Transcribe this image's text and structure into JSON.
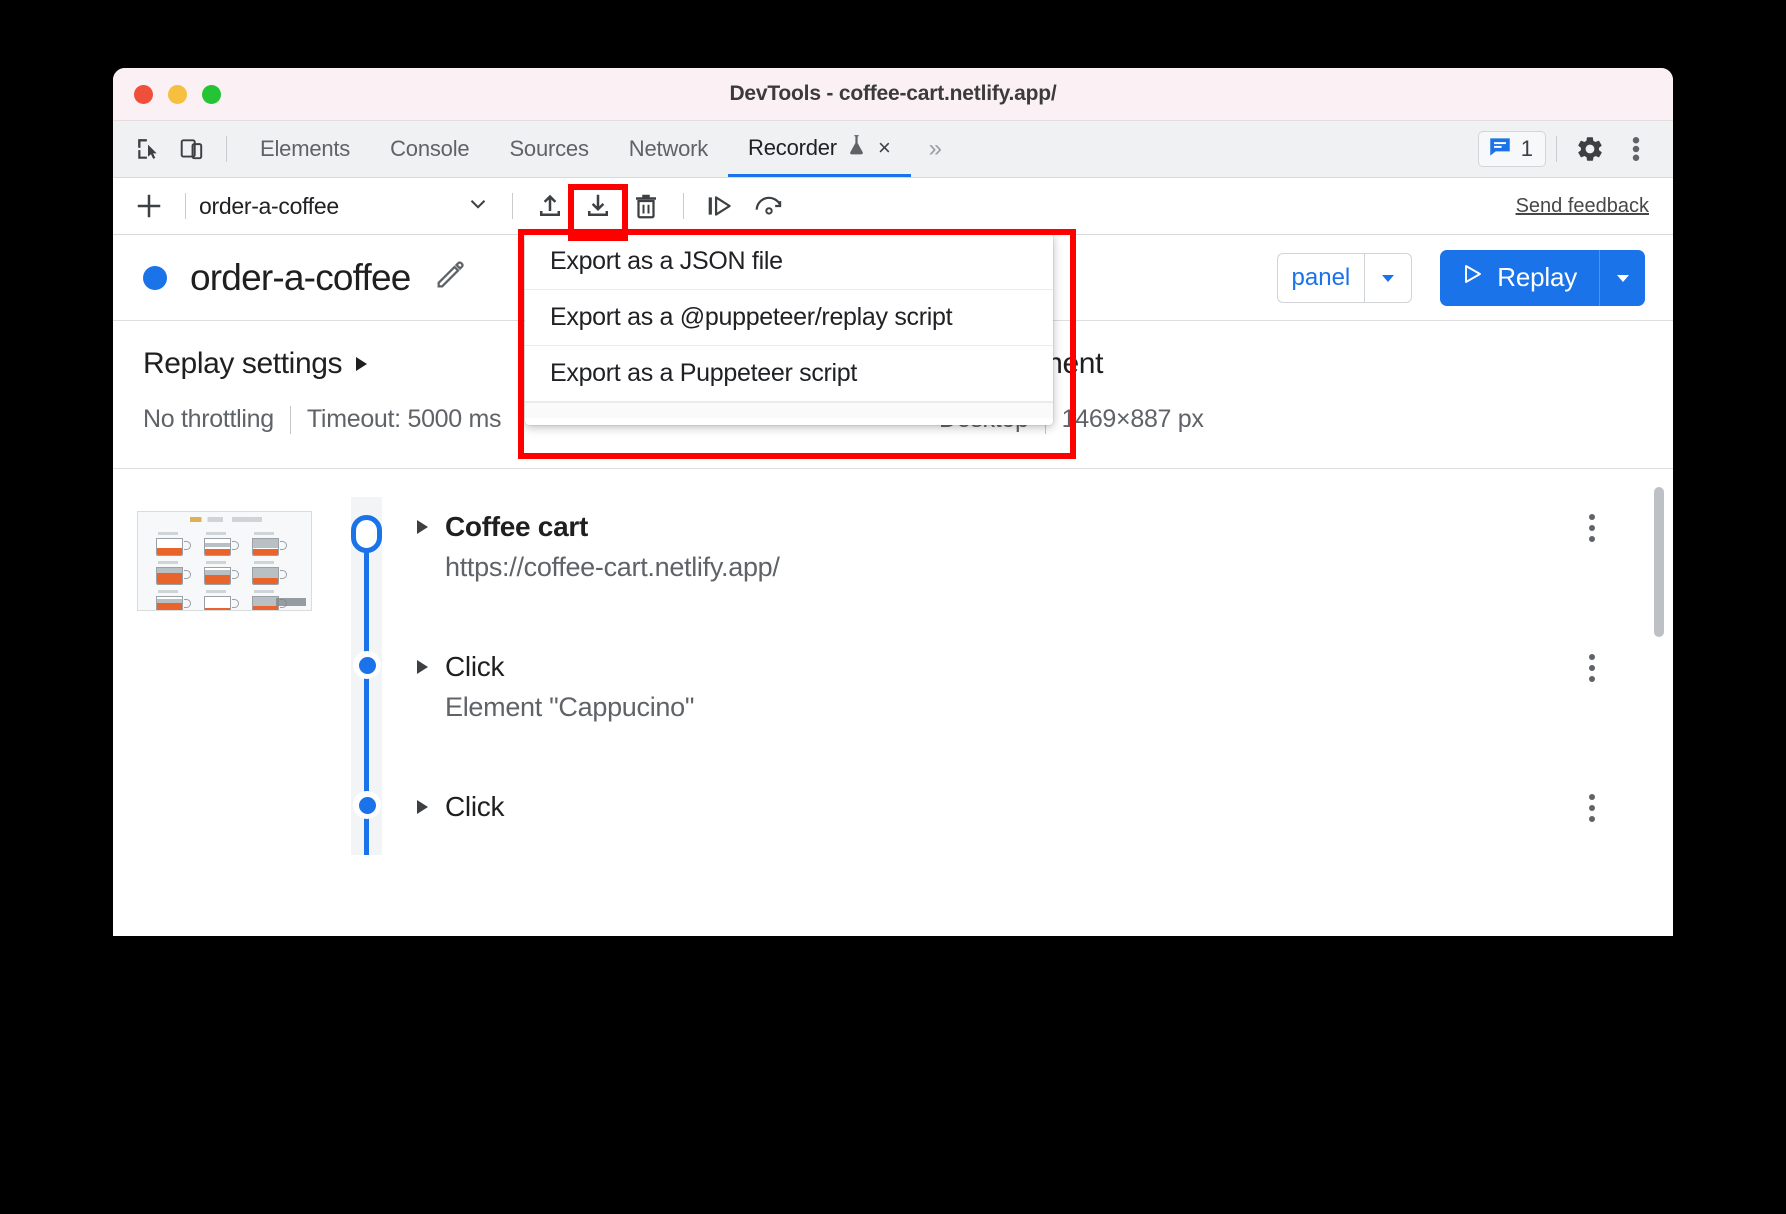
{
  "window": {
    "title": "DevTools - coffee-cart.netlify.app/",
    "traffic_lights": [
      "close",
      "minimize",
      "zoom"
    ]
  },
  "devtools_tabbar": {
    "left_icons": [
      {
        "name": "inspect-element-icon"
      },
      {
        "name": "device-toolbar-icon"
      }
    ],
    "tabs": [
      {
        "label": "Elements",
        "active": false
      },
      {
        "label": "Console",
        "active": false
      },
      {
        "label": "Sources",
        "active": false
      },
      {
        "label": "Network",
        "active": false
      },
      {
        "label": "Recorder",
        "active": true,
        "experimental": true,
        "closable": true
      }
    ],
    "more_tabs_label": "»",
    "tab_close_label": "×",
    "issues": {
      "icon": "issues-icon",
      "count": "1"
    },
    "settings_icon": "gear-icon",
    "main_menu_icon": "kebab-icon"
  },
  "recorder_toolbar": {
    "add_label": "+",
    "recording_name": "order-a-coffee",
    "dropdown_icon": "chevron-down-icon",
    "buttons": [
      {
        "name": "import-recording-button",
        "icon": "upload-icon"
      },
      {
        "name": "export-recording-button",
        "icon": "download-icon",
        "highlighted": true
      },
      {
        "name": "delete-recording-button",
        "icon": "trash-icon"
      },
      {
        "name": "step-by-step-replay-button",
        "icon": "step-play-icon"
      },
      {
        "name": "replay-with-reload-button",
        "icon": "reload-replay-icon"
      }
    ],
    "send_feedback": "Send feedback"
  },
  "export_menu": {
    "items": [
      {
        "label": "Export as a JSON file"
      },
      {
        "label": "Export as a @puppeteer/replay script"
      },
      {
        "label": "Export as a Puppeteer script"
      }
    ]
  },
  "recording_header": {
    "status_dot_color": "#1a73e8",
    "title": "order-a-coffee",
    "edit_icon": "pencil-icon",
    "show_code_label": "panel",
    "show_code_caret_icon": "caret-down-icon",
    "replay_label": "Replay",
    "replay_icon": "play-icon",
    "replay_caret_icon": "caret-down-icon"
  },
  "settings": {
    "replay_settings_title": "Replay settings",
    "replay_settings_expander_icon": "triangle-right-icon",
    "throttling": "No throttling",
    "timeout": "Timeout: 5000 ms",
    "environment_title": "Environment",
    "environment_device": "Desktop",
    "environment_viewport": "1469×887 px"
  },
  "steps": [
    {
      "name": "Coffee cart",
      "detail": "https://coffee-cart.netlify.app/",
      "bold": true,
      "node": "ring",
      "has_thumbnail": true,
      "kebab_icon": "kebab-icon",
      "expander_icon": "triangle-right-icon"
    },
    {
      "name": "Click",
      "detail": "Element \"Cappucino\"",
      "bold": false,
      "node": "dot",
      "has_thumbnail": false,
      "kebab_icon": "kebab-icon",
      "expander_icon": "triangle-right-icon"
    },
    {
      "name": "Click",
      "detail": "",
      "bold": false,
      "node": "dot",
      "has_thumbnail": false,
      "kebab_icon": "kebab-icon",
      "expander_icon": "triangle-right-icon"
    }
  ],
  "colors": {
    "accent_blue": "#1a73e8",
    "highlight_red": "#ff0000",
    "titlebar_bg": "#fbf0f4",
    "tabbar_bg": "#eff1f2"
  }
}
